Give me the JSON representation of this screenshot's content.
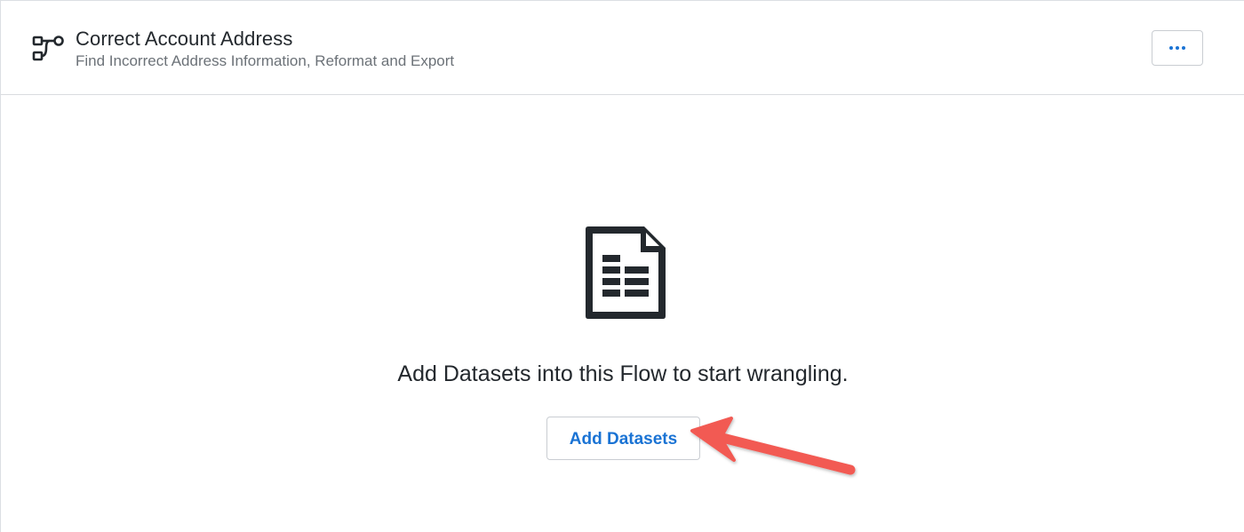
{
  "header": {
    "icon": "flow-icon",
    "title": "Correct Account Address",
    "subtitle": "Find Incorrect Address Information, Reformat and Export",
    "more_button_icon": "more-horizontal-icon"
  },
  "empty_state": {
    "icon": "dataset-document-icon",
    "message": "Add Datasets into this Flow to start wrangling.",
    "add_button_label": "Add Datasets"
  },
  "annotation": {
    "type": "arrow",
    "color": "#f25a52",
    "points_to": "add-datasets-button"
  },
  "colors": {
    "accent": "#1a73d4",
    "text": "#23282d",
    "muted_text": "#6c7278",
    "border": "#d9dcdf"
  }
}
